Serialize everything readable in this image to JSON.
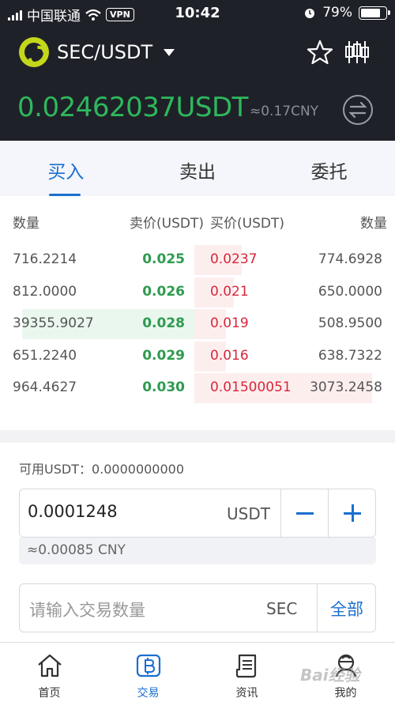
{
  "status_bar": {
    "carrier": "中国联通",
    "vpn": "VPN",
    "time": "10:42",
    "battery": "79%",
    "battery_level": 0.79
  },
  "header": {
    "pair": "SEC/USDT",
    "price": "0.02462037USDT",
    "price_cny": "≈0.17CNY",
    "price_color": "#2eb85c",
    "icons": {
      "logo": "sec-logo",
      "dropdown": "caret-down-icon",
      "favorite": "star-icon",
      "chart": "candlestick-icon",
      "swap": "swap-icon"
    }
  },
  "tabs": [
    {
      "label": "买入",
      "active": true
    },
    {
      "label": "卖出",
      "active": false
    },
    {
      "label": "委托",
      "active": false
    }
  ],
  "book": {
    "headers": {
      "sell_amount": "数量",
      "sell_price": "卖价(USDT)",
      "buy_price": "买价(USDT)",
      "buy_amount": "数量"
    },
    "rows": [
      {
        "sell_amount": "716.2214",
        "sell_price": "0.025",
        "buy_price": "0.0237",
        "buy_amount": "774.6928",
        "sell_depth": 0,
        "buy_depth": 0.24
      },
      {
        "sell_amount": "812.0000",
        "sell_price": "0.026",
        "buy_price": "0.021",
        "buy_amount": "650.0000",
        "sell_depth": 0,
        "buy_depth": 0.2
      },
      {
        "sell_amount": "39355.9027",
        "sell_price": "0.028",
        "buy_price": "0.019",
        "buy_amount": "508.9500",
        "sell_depth": 0.89,
        "buy_depth": 0.16
      },
      {
        "sell_amount": "651.2240",
        "sell_price": "0.029",
        "buy_price": "0.016",
        "buy_amount": "638.7322",
        "sell_depth": 0,
        "buy_depth": 0.16
      },
      {
        "sell_amount": "964.4627",
        "sell_price": "0.030",
        "buy_price": "0.01500051",
        "buy_amount": "3073.2458",
        "sell_depth": 0,
        "buy_depth": 0.9
      }
    ],
    "sell_color": "#2e9b4f",
    "buy_color": "#d7263b"
  },
  "form": {
    "available": "可用USDT：0.0000000000",
    "price_value": "0.0001248",
    "price_unit": "USDT",
    "price_cny": "≈0.00085 CNY",
    "qty_placeholder": "请输入交易数量",
    "qty_unit": "SEC",
    "qty_all": "全部"
  },
  "nav": [
    {
      "label": "首页",
      "icon": "home-icon",
      "active": false
    },
    {
      "label": "交易",
      "icon": "trade-icon",
      "active": true
    },
    {
      "label": "资讯",
      "icon": "news-icon",
      "active": false
    },
    {
      "label": "我的",
      "icon": "profile-icon",
      "active": false
    }
  ],
  "accent_color": "#1a6fcf",
  "watermark": "Bai经验"
}
